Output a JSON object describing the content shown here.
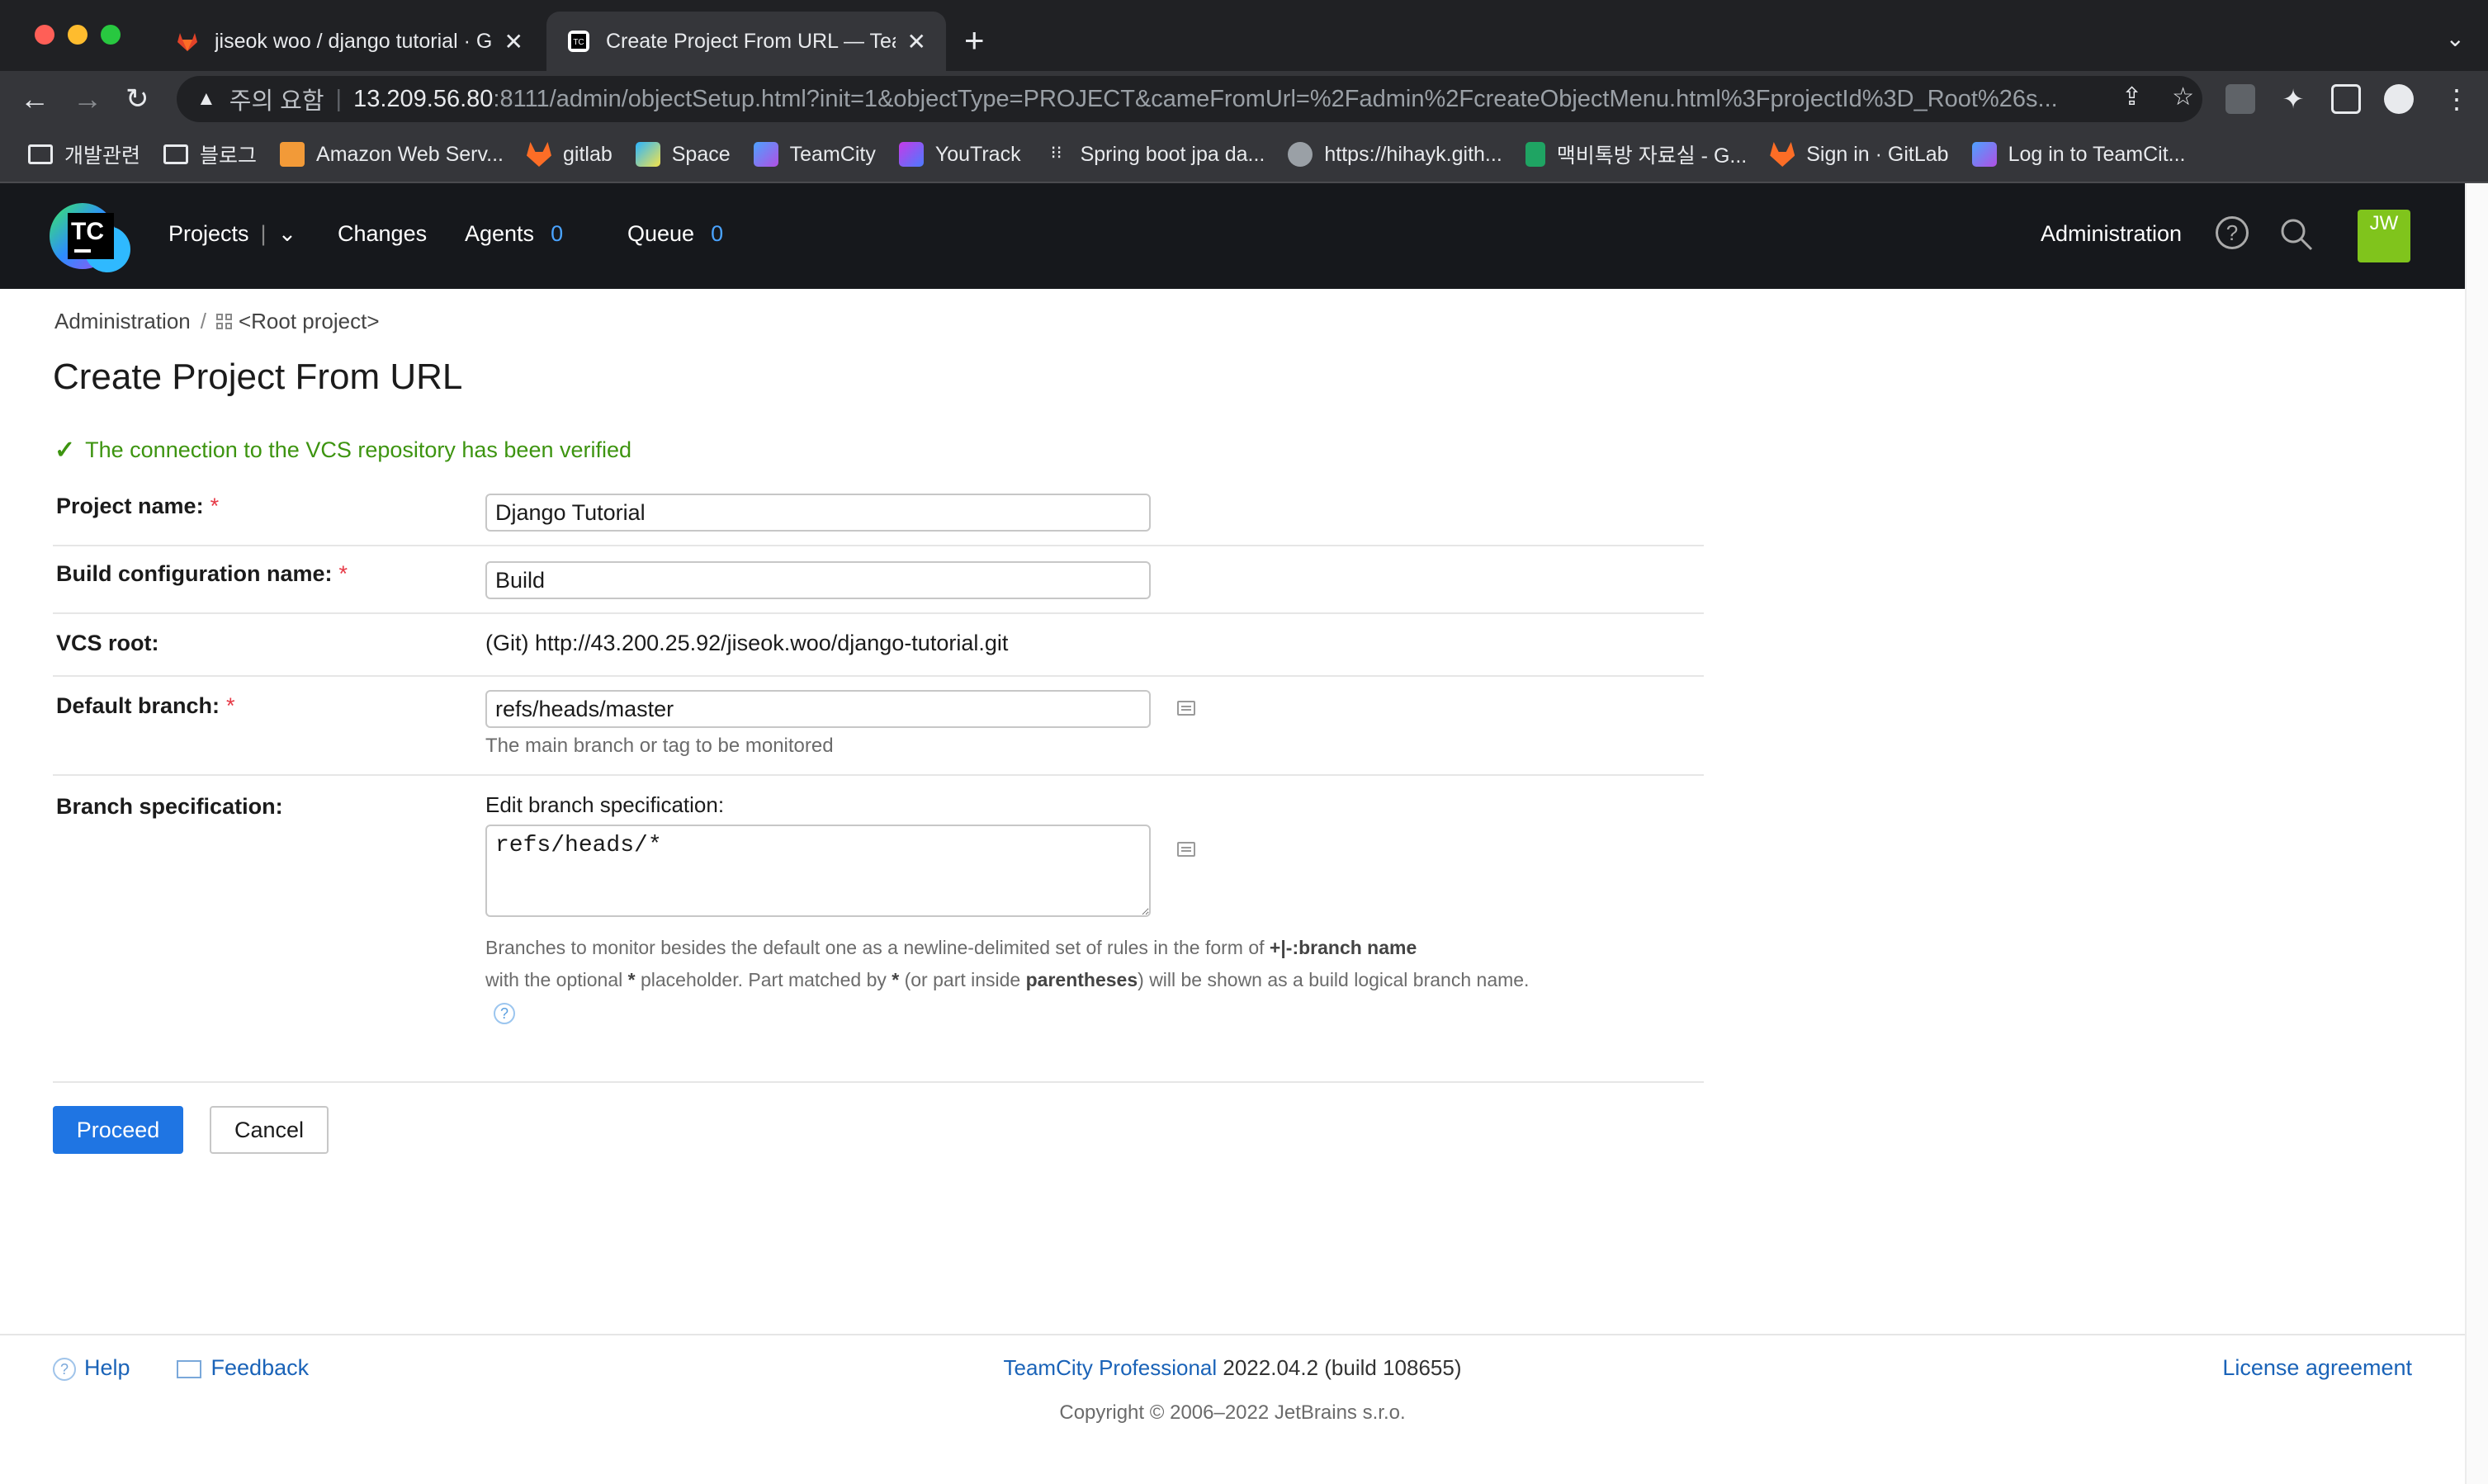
{
  "browser": {
    "tabs": [
      {
        "title": "jiseok woo / django tutorial · Gi",
        "active": false
      },
      {
        "title": "Create Project From URL — Tea",
        "active": true
      }
    ],
    "address": {
      "security_label": "주의 요함",
      "host": "13.209.56.80",
      "path": ":8111/admin/objectSetup.html?init=1&objectType=PROJECT&cameFromUrl=%2Fadmin%2FcreateObjectMenu.html%3FprojectId%3D_Root%26s..."
    },
    "bookmarks": [
      {
        "label": "개발관련",
        "icon": "folder-icon"
      },
      {
        "label": "블로그",
        "icon": "folder-icon"
      },
      {
        "label": "Amazon Web Serv...",
        "icon": "aws-icon"
      },
      {
        "label": "gitlab",
        "icon": "gitlab-icon"
      },
      {
        "label": "Space",
        "icon": "space-icon"
      },
      {
        "label": "TeamCity",
        "icon": "teamcity-icon"
      },
      {
        "label": "YouTrack",
        "icon": "youtrack-icon"
      },
      {
        "label": "Spring boot jpa da...",
        "icon": "dots-icon"
      },
      {
        "label": "https://hihayk.gith...",
        "icon": "globe-icon"
      },
      {
        "label": "맥비톡방 자료실 - G...",
        "icon": "sheets-icon"
      },
      {
        "label": "Sign in · GitLab",
        "icon": "gitlab-icon"
      },
      {
        "label": "Log in to TeamCit...",
        "icon": "teamcity-icon"
      }
    ]
  },
  "tc_header": {
    "logo_text": "TC",
    "nav": {
      "projects": "Projects",
      "changes": "Changes",
      "agents": "Agents",
      "agents_count": "0",
      "queue": "Queue",
      "queue_count": "0"
    },
    "administration": "Administration",
    "avatar_initials": "JW"
  },
  "breadcrumb": {
    "admin": "Administration",
    "sep": "/",
    "root": "<Root project>"
  },
  "page": {
    "title": "Create Project From URL",
    "success_message": "The connection to the VCS repository has been verified"
  },
  "form": {
    "project_name": {
      "label": "Project name:",
      "value": "Django Tutorial"
    },
    "build_config_name": {
      "label": "Build configuration name:",
      "value": "Build"
    },
    "vcs_root": {
      "label": "VCS root:",
      "value": "(Git) http://43.200.25.92/jiseok.woo/django-tutorial.git"
    },
    "default_branch": {
      "label": "Default branch:",
      "value": "refs/heads/master",
      "hint": "The main branch or tag to be monitored"
    },
    "branch_spec": {
      "label": "Branch specification:",
      "edit_label": "Edit branch specification:",
      "value": "refs/heads/*",
      "note_1": "Branches to monitor besides the default one as a newline-delimited set of rules in the form of ",
      "note_bold_1": "+|-:branch name",
      "note_2": "with the optional ",
      "note_bold_2": "*",
      "note_3": " placeholder. Part matched by ",
      "note_bold_3": "*",
      "note_4": " (or part inside ",
      "note_bold_4": "parentheses",
      "note_5": ") will be shown as a build logical branch name."
    },
    "required_mark": "*"
  },
  "actions": {
    "proceed": "Proceed",
    "cancel": "Cancel"
  },
  "footer": {
    "help": "Help",
    "feedback": "Feedback",
    "product": "TeamCity Professional",
    "version": "2022.04.2 (build 108655)",
    "copyright": "Copyright © 2006–2022 JetBrains s.r.o.",
    "license": "License agreement"
  },
  "colors": {
    "accent": "#1f75e3",
    "success": "#3d9410",
    "header_bg": "#16181c",
    "avatar": "#80c41c"
  }
}
